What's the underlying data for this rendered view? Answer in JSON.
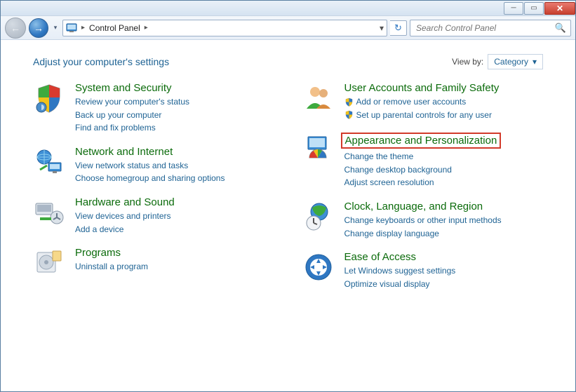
{
  "window": {
    "minimize_glyph": "─",
    "maximize_glyph": "▭",
    "close_glyph": "✕"
  },
  "toolbar": {
    "back_glyph": "←",
    "forward_glyph": "→",
    "dropdown_glyph": "▾",
    "refresh_glyph": "↻",
    "breadcrumb_sep": "▸",
    "breadcrumb_current": "Control Panel",
    "address_dropdown_glyph": "▾"
  },
  "search": {
    "placeholder": "Search Control Panel",
    "icon_glyph": "🔍"
  },
  "header": {
    "title": "Adjust your computer's settings",
    "viewby_label": "View by:",
    "viewby_value": "Category",
    "viewby_caret": "▾"
  },
  "categories": {
    "left": [
      {
        "icon": "shield-icon",
        "title": "System and Security",
        "links": [
          {
            "text": "Review your computer's status",
            "shield": false
          },
          {
            "text": "Back up your computer",
            "shield": false
          },
          {
            "text": "Find and fix problems",
            "shield": false
          }
        ]
      },
      {
        "icon": "network-icon",
        "title": "Network and Internet",
        "links": [
          {
            "text": "View network status and tasks",
            "shield": false
          },
          {
            "text": "Choose homegroup and sharing options",
            "shield": false
          }
        ]
      },
      {
        "icon": "hardware-icon",
        "title": "Hardware and Sound",
        "links": [
          {
            "text": "View devices and printers",
            "shield": false
          },
          {
            "text": "Add a device",
            "shield": false
          }
        ]
      },
      {
        "icon": "programs-icon",
        "title": "Programs",
        "links": [
          {
            "text": "Uninstall a program",
            "shield": false
          }
        ]
      }
    ],
    "right": [
      {
        "icon": "users-icon",
        "title": "User Accounts and Family Safety",
        "links": [
          {
            "text": "Add or remove user accounts",
            "shield": true
          },
          {
            "text": "Set up parental controls for any user",
            "shield": true
          }
        ]
      },
      {
        "icon": "appearance-icon",
        "title": "Appearance and Personalization",
        "highlight": true,
        "links": [
          {
            "text": "Change the theme",
            "shield": false
          },
          {
            "text": "Change desktop background",
            "shield": false
          },
          {
            "text": "Adjust screen resolution",
            "shield": false
          }
        ]
      },
      {
        "icon": "clock-icon",
        "title": "Clock, Language, and Region",
        "links": [
          {
            "text": "Change keyboards or other input methods",
            "shield": false
          },
          {
            "text": "Change display language",
            "shield": false
          }
        ]
      },
      {
        "icon": "ease-icon",
        "title": "Ease of Access",
        "links": [
          {
            "text": "Let Windows suggest settings",
            "shield": false
          },
          {
            "text": "Optimize visual display",
            "shield": false
          }
        ]
      }
    ]
  }
}
